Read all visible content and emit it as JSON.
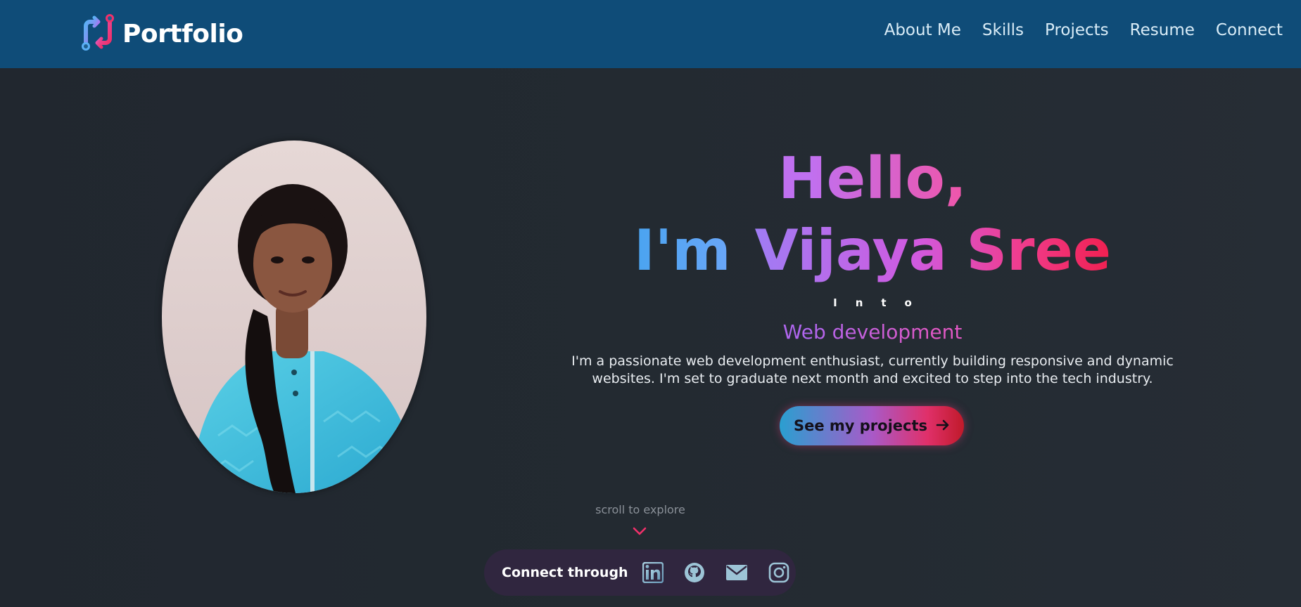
{
  "header": {
    "brand": "Portfolio",
    "nav": [
      "About Me",
      "Skills",
      "Projects",
      "Resume",
      "Connect"
    ]
  },
  "hero": {
    "greeting": "Hello,",
    "im": "I'm",
    "name": "Vijaya Sree",
    "into": "Into",
    "role": "Web development",
    "bio_line1": "I'm a passionate web development enthusiast, currently building responsive and dynamic",
    "bio_line2": "websites. I'm set to graduate next month and excited to step into the tech industry.",
    "cta_label": "See my projects"
  },
  "scroll_hint": "scroll to explore",
  "connect": {
    "label": "Connect through",
    "icons": [
      "linkedin-icon",
      "github-icon",
      "mail-icon",
      "instagram-icon"
    ]
  },
  "colors": {
    "header_bg": "#0f4c78",
    "page_bg": "#232a31",
    "accent_pink": "#f0306a",
    "accent_purple": "#c070f0",
    "accent_blue": "#4aa4f0"
  }
}
